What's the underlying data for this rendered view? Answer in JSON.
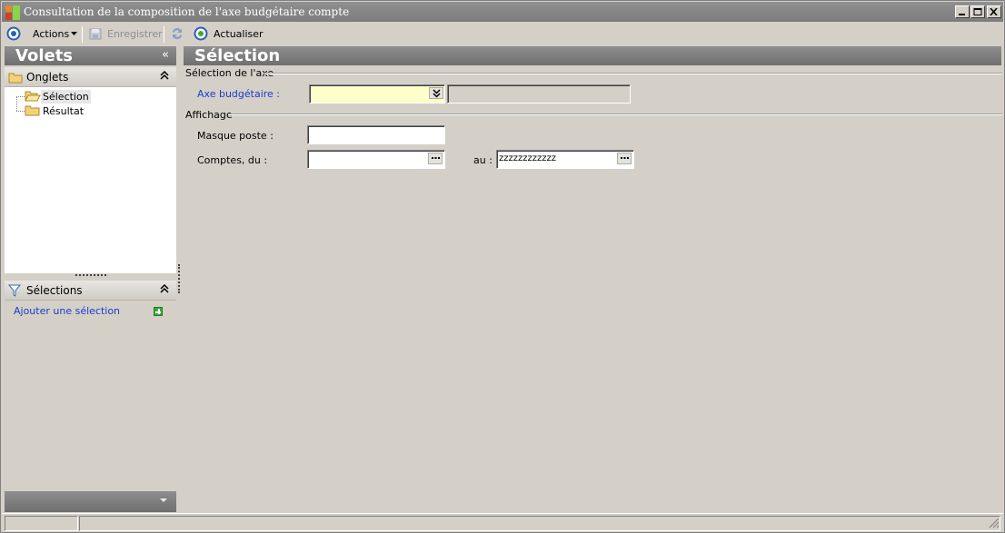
{
  "window": {
    "title": "Consultation de la composition de l'axe budgétaire compte"
  },
  "toolbar": {
    "actions_label": "Actions",
    "save_label": "Enregistrer",
    "refresh_label": "Actualiser"
  },
  "left_panel": {
    "title": "Volets",
    "tabs_section": {
      "title": "Onglets",
      "items": [
        {
          "label": "Sélection",
          "selected": true
        },
        {
          "label": "Résultat",
          "selected": false
        }
      ]
    },
    "selections_section": {
      "title": "Sélections",
      "add_link": "Ajouter une sélection"
    }
  },
  "main": {
    "title": "Sélection",
    "axis_group": {
      "label": "Sélection de l'axe",
      "axe_label": "Axe budgétaire :",
      "axe_value": "",
      "axe_description": ""
    },
    "display_group": {
      "label": "Affichage",
      "masque_label": "Masque poste :",
      "masque_value": "",
      "comptes_label": "Comptes, du :",
      "comptes_from_value": "",
      "au_label": "au :",
      "comptes_to_value": "zzzzzzzzzzzz"
    }
  },
  "icons": {
    "app": "app-logo-icon",
    "actions": "actions-circle-icon",
    "save": "save-icon",
    "sync": "sync-icon",
    "refresh": "refresh-icon",
    "folder": "folder-icon",
    "filter": "filter-funnel-icon",
    "add": "add-plus-icon"
  },
  "colors": {
    "header_bar": "#7d7d7d",
    "link_blue": "#1a3ccc",
    "mandatory_field_bg": "#ffffcc",
    "background": "#d4d0c8"
  }
}
